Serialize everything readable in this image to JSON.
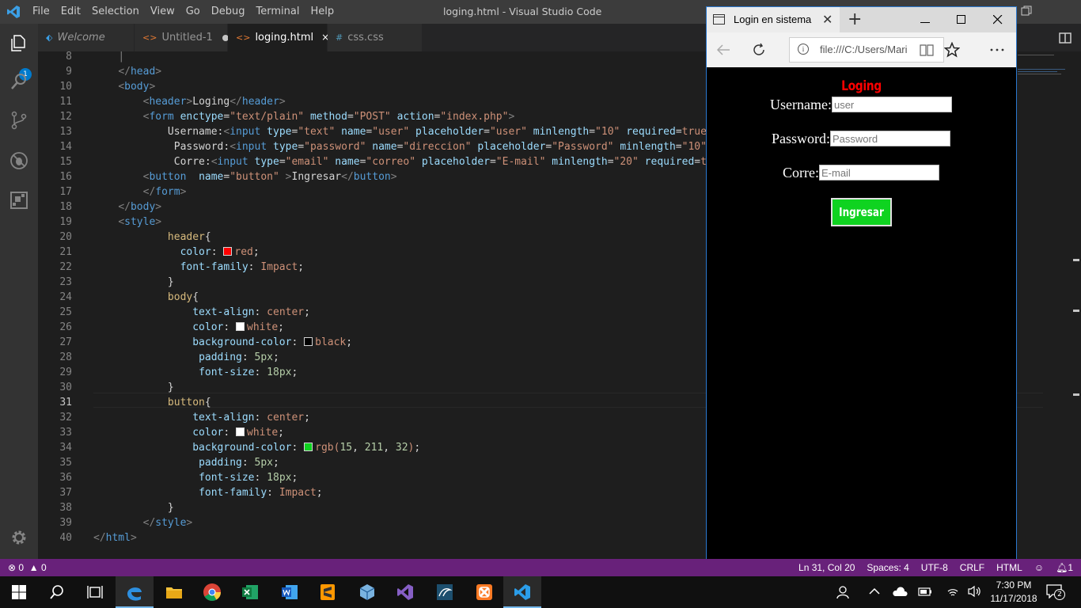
{
  "window": {
    "title": "loging.html - Visual Studio Code",
    "menu": [
      "File",
      "Edit",
      "Selection",
      "View",
      "Go",
      "Debug",
      "Terminal",
      "Help"
    ]
  },
  "activity": {
    "icons": [
      "explorer-icon",
      "search-icon",
      "source-control-icon",
      "debug-icon",
      "extensions-icon",
      "settings-gear-icon"
    ],
    "badge": "1"
  },
  "tabs": [
    {
      "label": "Welcome",
      "icon": "vscode-icon",
      "italic": true
    },
    {
      "label": "Untitled-1",
      "icon": "html-icon",
      "dirty": true
    },
    {
      "label": "loging.html",
      "icon": "html-icon",
      "active": true,
      "close": "×"
    },
    {
      "label": "css.css",
      "icon": "css-icon"
    }
  ],
  "editor": {
    "current_line": 31,
    "swatch_colors": {
      "red": "#ff0000",
      "white": "#ffffff",
      "black": "#000000",
      "green": "#0fd320"
    },
    "line_numbers": [
      "8",
      "9",
      "10",
      "11",
      "12",
      "13",
      "14",
      "15",
      "16",
      "17",
      "18",
      "19",
      "20",
      "21",
      "22",
      "23",
      "24",
      "25",
      "26",
      "27",
      "28",
      "29",
      "30",
      "31",
      "32",
      "33",
      "34",
      "35",
      "36",
      "37",
      "38",
      "39",
      "40"
    ]
  },
  "browser": {
    "tab_title": "Login en sistema",
    "tab_close": "✕",
    "new_tab": "+",
    "url": "file:///C:/Users/Mari",
    "page": {
      "header": "Loging",
      "username_label": "Username:",
      "username_placeholder": "user",
      "password_label": "Password:",
      "password_placeholder": "Password",
      "email_label": "Corre:",
      "email_placeholder": "E-mail",
      "button": "Ingresar"
    }
  },
  "statusbar": {
    "errors": "0",
    "warnings": "0",
    "position": "Ln 31, Col 20",
    "spaces": "Spaces: 4",
    "encoding": "UTF-8",
    "eol": "CRLF",
    "language": "HTML",
    "notifications": "1"
  },
  "taskbar": {
    "apps": [
      "windows-start-icon",
      "search-icon",
      "task-view-icon",
      "edge-icon",
      "file-explorer-icon",
      "chrome-icon",
      "excel-icon",
      "word-icon",
      "sublime-icon",
      "virtualbox-icon",
      "visual-studio-icon",
      "mysql-workbench-icon",
      "xampp-icon",
      "vscode-icon"
    ],
    "time": "7:30 PM",
    "date": "11/17/2018",
    "notification_count": "2"
  }
}
